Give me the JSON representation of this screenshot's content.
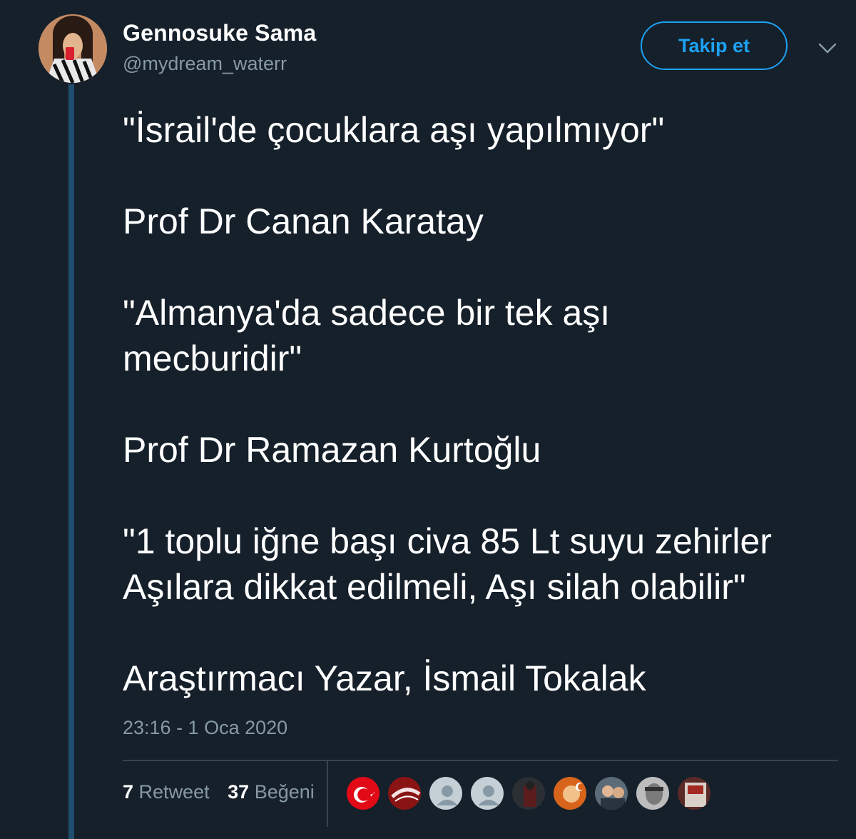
{
  "tweet": {
    "author_name": "Gennosuke Sama",
    "author_handle": "@mydream_waterr",
    "follow_label": "Takip et",
    "lines": {
      "l1": "\"İsrail'de çocuklara aşı yapılmıyor\"",
      "l2": "Prof Dr Canan Karatay",
      "l3": "\"Almanya'da sadece bir tek aşı",
      "l4": "mecburidir\"",
      "l5": "Prof Dr Ramazan Kurtoğlu",
      "l6": "\"1 toplu iğne başı civa 85 Lt suyu zehirler",
      "l7": "Aşılara dikkat edilmeli, Aşı silah olabilir\"",
      "l8": "Araştırmacı Yazar, İsmail Tokalak"
    },
    "timestamp": "23:16 - 1 Oca 2020",
    "retweet_count": "7",
    "retweet_label": "Retweet",
    "like_count": "37",
    "like_label": "Beğeni"
  },
  "icons": {
    "more": "chevron-down-icon",
    "likers": [
      "turkish-flag-avatar",
      "red-logo-avatar",
      "default-profile-avatar",
      "default-profile-avatar",
      "dark-photo-avatar",
      "flag-portrait-avatar",
      "couple-photo-avatar",
      "portrait-bw-avatar",
      "red-poster-avatar"
    ]
  },
  "colors": {
    "background": "#15202b",
    "accent": "#1da1f2",
    "muted": "#8899a6",
    "divider": "#38444d",
    "thread_line": "#1f4e6e"
  }
}
